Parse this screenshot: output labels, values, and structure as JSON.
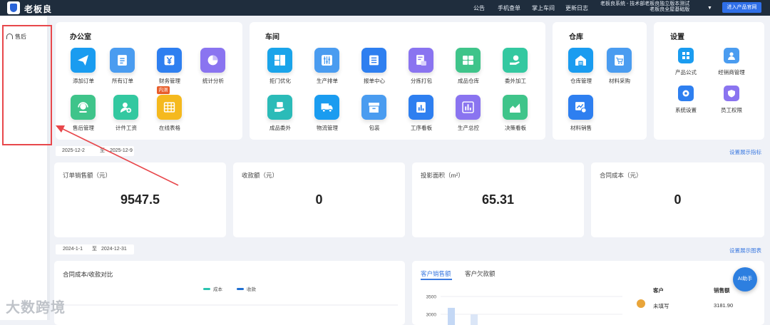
{
  "brand": {
    "name": "老板良"
  },
  "topnav": {
    "items": [
      "公告",
      "手机查单",
      "掌上车间",
      "更新日志"
    ],
    "system_line1": "老板良系统 - 技术部老板良独立版本测试",
    "system_line2": "老板良全屋基础版",
    "enter_button": "进入产品官网"
  },
  "sidebar": {
    "items": [
      {
        "label": "售后",
        "icon": "headset-icon"
      }
    ]
  },
  "sections": {
    "office": {
      "title": "办公室",
      "tiles": [
        {
          "label": "添加订单",
          "icon": "paper-plane-icon",
          "color": "#1a9cf0"
        },
        {
          "label": "所有订单",
          "icon": "document-list-icon",
          "color": "#4a9cf0"
        },
        {
          "label": "财务管理",
          "icon": "yuan-icon",
          "color": "#2e7ff0"
        },
        {
          "label": "统计分析",
          "icon": "pie-chart-icon",
          "color": "#8a74f0"
        },
        {
          "label": "售后管理",
          "icon": "customer-service-icon",
          "color": "#3fc48a"
        },
        {
          "label": "计件工资",
          "icon": "user-plus-icon",
          "color": "#33c8a0"
        },
        {
          "label": "在线表格",
          "icon": "table-icon",
          "color": "#f5b91e",
          "badge": "内测"
        }
      ]
    },
    "workshop": {
      "title": "车间",
      "tiles": [
        {
          "label": "拒门优化",
          "icon": "layout-icon",
          "color": "#1aa4ea"
        },
        {
          "label": "生产排单",
          "icon": "sliders-icon",
          "color": "#4a9cf0"
        },
        {
          "label": "报单中心",
          "icon": "clipboard-list-icon",
          "color": "#2e7ff0"
        },
        {
          "label": "分拣打包",
          "icon": "print-icon",
          "color": "#8a74f0"
        },
        {
          "label": "成品仓库",
          "icon": "grid-box-icon",
          "color": "#3fc48a"
        },
        {
          "label": "委外加工",
          "icon": "hand-gear-icon",
          "color": "#33c8a0"
        },
        {
          "label": "成品委外",
          "icon": "box-hand-icon",
          "color": "#2bbbb8"
        },
        {
          "label": "物流管理",
          "icon": "truck-icon",
          "color": "#1a9cf0"
        },
        {
          "label": "包装",
          "icon": "archive-icon",
          "color": "#4a9cf0"
        },
        {
          "label": "工序看板",
          "icon": "report-chart-icon",
          "color": "#2e7ff0"
        },
        {
          "label": "生产总控",
          "icon": "bar-chart-icon",
          "color": "#8a74f0"
        },
        {
          "label": "决策看板",
          "icon": "area-chart-icon",
          "color": "#3fc48a"
        }
      ]
    },
    "warehouse": {
      "title": "仓库",
      "tiles": [
        {
          "label": "仓库管理",
          "icon": "warehouse-icon",
          "color": "#1a9cf0"
        },
        {
          "label": "材料采购",
          "icon": "cart-doc-icon",
          "color": "#4a9cf0"
        },
        {
          "label": "材料销售",
          "icon": "sales-chart-icon",
          "color": "#2e7ff0"
        }
      ]
    },
    "settings": {
      "title": "设置",
      "tiles": [
        {
          "label": "产品公式",
          "icon": "grid-icon",
          "color": "#1a9cf0"
        },
        {
          "label": "经销商管理",
          "icon": "user-icon",
          "color": "#4a9cf0"
        },
        {
          "label": "系统设置",
          "icon": "gear-icon",
          "color": "#2e7ff0"
        },
        {
          "label": "员工权限",
          "icon": "shield-icon",
          "color": "#8a74f0"
        }
      ]
    }
  },
  "range1": {
    "start": "2025-12-2",
    "sep": "至",
    "end": "2025-12-9",
    "link": "设置展示指标"
  },
  "kpis": [
    {
      "title": "订单销售额（元）",
      "value": "9547.5"
    },
    {
      "title": "收款额（元）",
      "value": "0"
    },
    {
      "title": "投影面积（m²）",
      "value": "65.31"
    },
    {
      "title": "合同成本（元）",
      "value": "0"
    }
  ],
  "range2": {
    "start": "2024-1-1",
    "sep": "至",
    "end": "2024-12-31",
    "link": "设置展示图表"
  },
  "chart_data": [
    {
      "type": "line",
      "title": "合同成本/收款对比",
      "series": [
        {
          "name": "成本",
          "values": []
        },
        {
          "name": "收款",
          "values": []
        }
      ],
      "colors": [
        "#2bc4b0",
        "#1f6fd1"
      ]
    },
    {
      "type": "bar",
      "tabs": [
        "客户销售额",
        "客户欠款额"
      ],
      "active_tab": "客户销售额",
      "y_ticks": [
        3500,
        3000
      ],
      "values": [
        3181.9,
        3000
      ],
      "table": {
        "headers": [
          "客户",
          "销售额"
        ],
        "rows": [
          [
            "未填写",
            "3181.90"
          ]
        ]
      }
    }
  ],
  "ai_button": "AI助手",
  "watermark": "大数跨境"
}
